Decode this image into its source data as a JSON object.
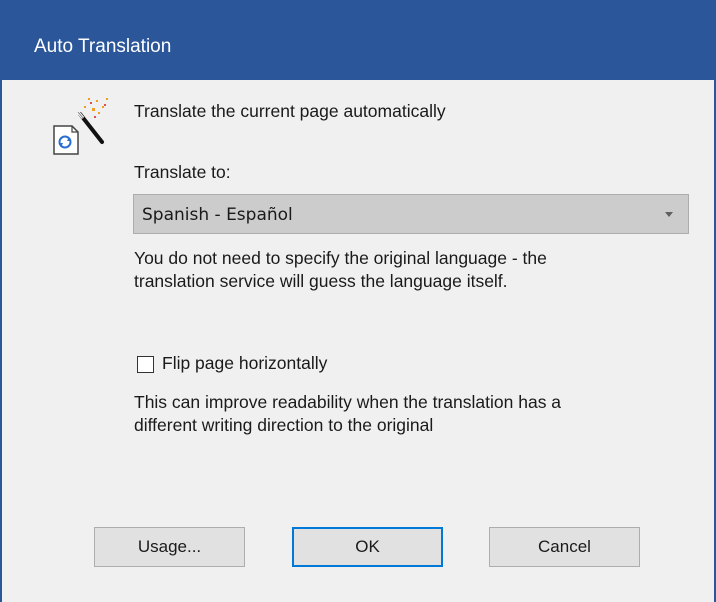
{
  "window": {
    "title": "Auto Translation"
  },
  "header": {
    "icon": "magic-wand-translate-icon",
    "description": "Translate the current page automatically"
  },
  "translate": {
    "label": "Translate to:",
    "selected": "Spanish - Español",
    "hint_line1": "You do not need to specify the original language - the",
    "hint_line2": "translation service will guess the language itself."
  },
  "flip": {
    "label": "Flip page horizontally",
    "checked": false,
    "hint_line1": "This can improve readability when the translation has a",
    "hint_line2": "different writing direction to the original"
  },
  "buttons": {
    "usage": "Usage...",
    "ok": "OK",
    "cancel": "Cancel"
  },
  "colors": {
    "titlebar": "#2b579a",
    "background": "#f0f0f0",
    "default_button_border": "#0078d7"
  }
}
